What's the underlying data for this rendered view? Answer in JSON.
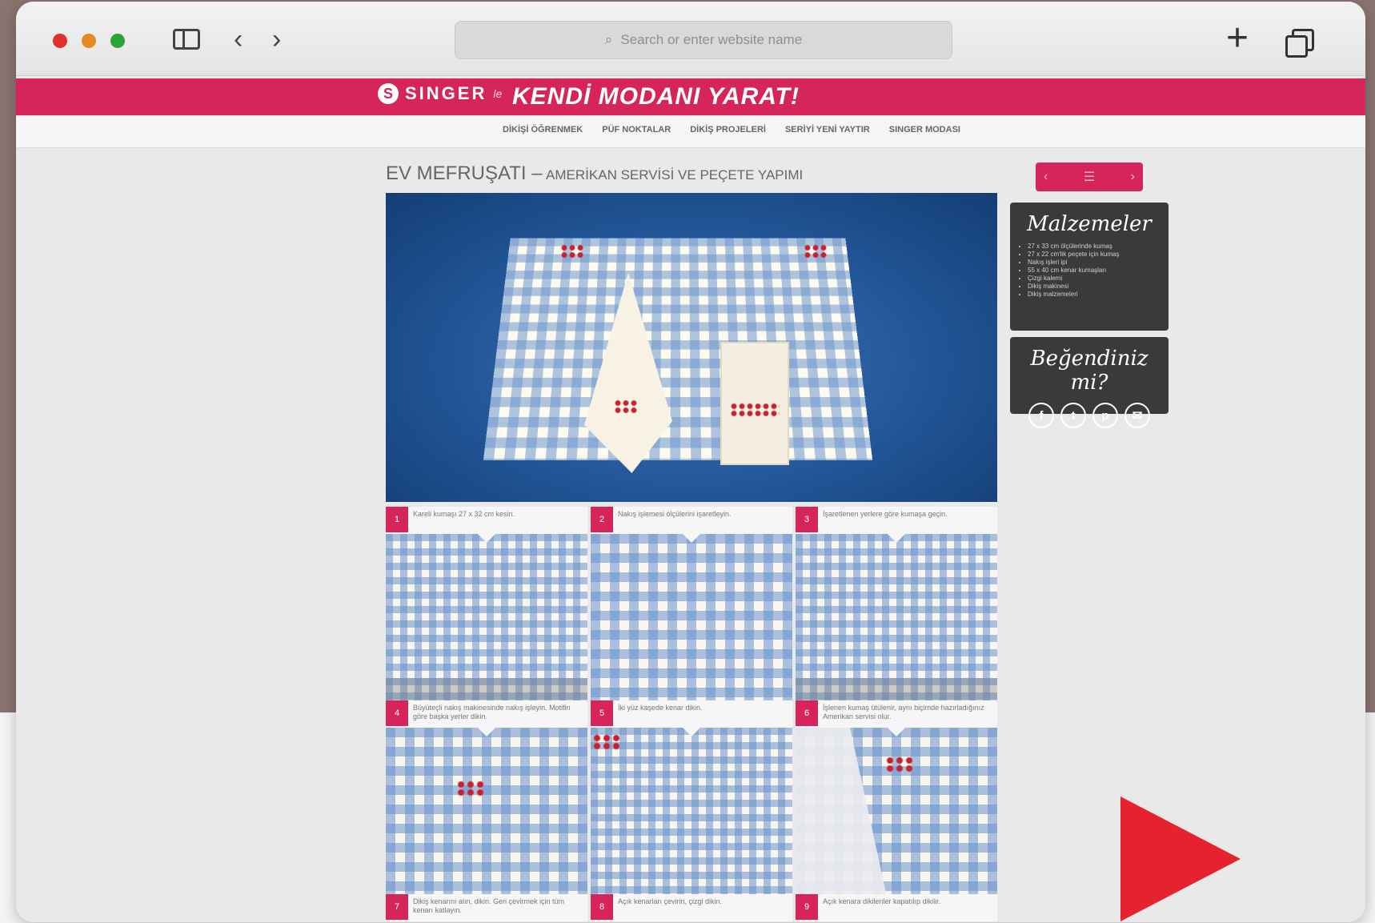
{
  "browser": {
    "address_placeholder": "Search or enter website name",
    "back_glyph": "‹",
    "forward_glyph": "›",
    "new_tab_glyph": "+"
  },
  "site": {
    "logo_text": "SINGER",
    "logo_initial": "S",
    "logo_tail": "le",
    "slogan": "KENDİ MODANI YARAT!",
    "brand_color": "#d6255a"
  },
  "subnav": {
    "items": [
      "DİKİŞİ ÖĞRENMEK",
      "PÜF NOKTALAR",
      "DİKİŞ PROJELERİ",
      "SERİYİ YENİ YAYTIR",
      "SINGER MODASI"
    ]
  },
  "page": {
    "title_main": "EV MEFRUŞATI –",
    "title_sub": "AMERİKAN SERVİSİ VE PEÇETE YAPIMI"
  },
  "sidebar": {
    "nav_prev": "‹",
    "nav_menu": "☰",
    "nav_next": "›",
    "materials_title": "Malzemeler",
    "materials_items": [
      "27 x 33 cm ölçülerinde kumaş",
      "27 x 22 cm'lik peçete için kumaş",
      "Nakış işleri ipi",
      "55 x 40 cm kenar kumaşları",
      "Çizgi kalemi",
      "Dikiş makinesi",
      "Dikiş malzemeleri"
    ],
    "like_title": "Beğendiniz mi?",
    "social_icons": [
      "facebook-icon",
      "twitter-icon",
      "pinterest-icon",
      "email-icon"
    ],
    "social_glyphs": [
      "f",
      "t",
      "p",
      "✉"
    ]
  },
  "steps": [
    {
      "num": "1",
      "text": "Kareli kumaşı 27 x 32 cm kesin."
    },
    {
      "num": "2",
      "text": "Nakış işlemesi ölçülerini işaretleyin."
    },
    {
      "num": "3",
      "text": "İşaretlenen yerlere göre kumaşa geçin."
    },
    {
      "num": "4",
      "text": "Büyüteçli nakış makinesinde nakış işleyin. Motifin göre başka yerler dikin."
    },
    {
      "num": "5",
      "text": "İki yüz kaşede kenar dikin."
    },
    {
      "num": "6",
      "text": "İşlenen kumaş ütülenir, aynı biçimde hazırladığınız Amerikan servisi olur."
    },
    {
      "num": "7",
      "text": "Dikiş kenarını alın, dikin. Geri çevirmek için tüm kenarı katlayın."
    },
    {
      "num": "8",
      "text": "Açık kenarları çevirin, çizgi dikin."
    },
    {
      "num": "9",
      "text": "Açık kenara dikilenler kapatılıp dikilir."
    }
  ]
}
